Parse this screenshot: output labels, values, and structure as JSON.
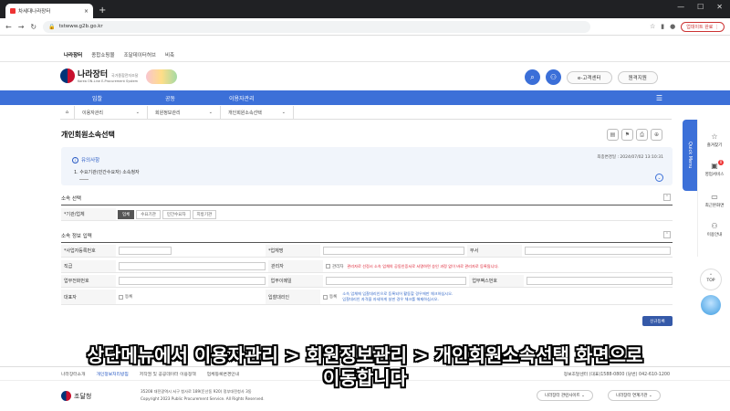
{
  "browser": {
    "tab_title": "차세대나라장터",
    "tab_close": "×",
    "new_tab": "+",
    "url": "tstwww.g2b.go.kr",
    "update_button": "업데이트 완료 ⋮",
    "win_min": "—",
    "win_max": "☐",
    "win_close": "✕"
  },
  "gnb": [
    "나라장터",
    "종합쇼핑몰",
    "조달데이터허브",
    "비축"
  ],
  "header": {
    "logo_text": "나라장터",
    "logo_sub": "Korea ON-Line E-Procurement System",
    "logo_tag": "국가종합전자조달",
    "customer_center": "e-고객센터",
    "remote_support": "원격지원"
  },
  "mainnav": {
    "m1": "입찰",
    "m2": "공동",
    "m3": "이용자관리",
    "menu": "☰"
  },
  "breadcrumb": {
    "home": "⌂",
    "seg1": "이용자관리",
    "seg2": "회원정보관리",
    "seg3": "개인회원소속선택",
    "caret": "⌄"
  },
  "page_title": "개인회원소속선택",
  "notice": {
    "heading": "유의사항",
    "item1": "1. 수요기관(민간수요자) 소속청자",
    "date": "최종변경일 : 2024/07/02 13:10:31"
  },
  "sec1": {
    "title": "소속 선택",
    "label": "*기관/업체",
    "options": [
      "업체",
      "수요기관",
      "민간수요자",
      "지방기관"
    ]
  },
  "sec2": {
    "title": "소속 정보 입력",
    "biz_no": "*사업자등록번호",
    "company": "*업체명",
    "dept": "부서",
    "position": "직급",
    "manager": "관리자",
    "manager_chk": "관리자",
    "manager_note": "관리자로 선정시 소속 업체의 공동인증서로 서명하면 승인 과정 없이 바로 관리자로 등록됩니다.",
    "phone": "업무전화번호",
    "email": "업무이메일",
    "fax": "업무팩스번호",
    "ceo": "대표자",
    "ceo_chk": "등록",
    "bidder": "입찰대리인",
    "bidder_chk": "등록",
    "bidder_note1": "소속 업체에 입찰대리인으로 등록되어 활동할 경우에만 체크하십시오.",
    "bidder_note2": "입찰대리인 자격을 자세하게 살핀 경우 체크를 해제하십시오."
  },
  "new_register": "신규등록",
  "footer": {
    "links": [
      "나라장터소개",
      "개인정보처리방침",
      "저작권 및 공공데이터 이용정책",
      "업체등록변경안내"
    ],
    "contact": "정보조달센터 (대표)1588-0800 (당번) 042-610-1200",
    "org": "조달청",
    "addr1": "35208 대전광역시 서구 청사로 189(둔산동 920) 정부대전청사 3동",
    "addr2": "Copyright 2023 Public Procurement Service. All Rights Reserved.",
    "related": "나라장터 관련사이트",
    "linked": "나라장터 연계기관"
  },
  "quick": {
    "label": "Quick Menu",
    "fav": "즐겨찾기",
    "sales": "영업서비스",
    "sales_badge": "0",
    "recent": "최근본화면",
    "guide": "이용안내",
    "top": "TOP"
  },
  "caption": {
    "line1": "상단메뉴에서 이용자관리 > 회원정보관리 > 개인회원소속선택 화면으로",
    "line2": "이동합니다"
  },
  "colors": {
    "accent": "#3c70d8",
    "dark_btn": "#3559a8",
    "warn": "#d23"
  }
}
